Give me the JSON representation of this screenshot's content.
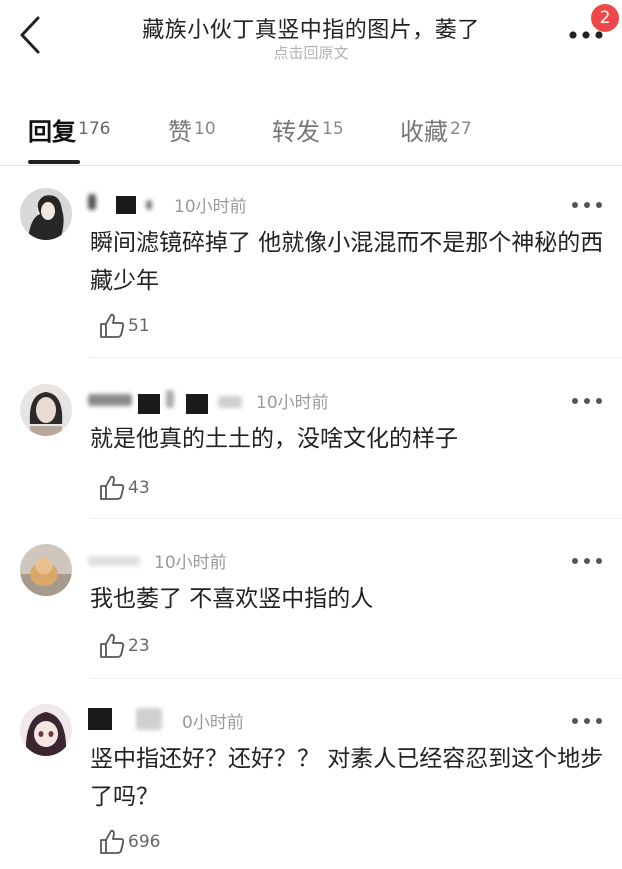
{
  "header": {
    "title": "藏族小伙丁真竖中指的图片，萎了",
    "subtitle": "点击回原文",
    "notification_badge": "2",
    "back_icon": "chevron-left-icon",
    "more_icon": "more-dots-icon"
  },
  "tabs": [
    {
      "label": "回复",
      "count": "176",
      "active": true
    },
    {
      "label": "赞",
      "count": "10",
      "active": false
    },
    {
      "label": "转发",
      "count": "15",
      "active": false
    },
    {
      "label": "收藏",
      "count": "27",
      "active": false
    }
  ],
  "comments": [
    {
      "time": "10小时前",
      "text": "瞬间滤镜碎掉了 他就像小混混而不是那个神秘的西藏少年",
      "likes": "51"
    },
    {
      "time": "10小时前",
      "text": "就是他真的土土的，没啥文化的样子",
      "likes": "43"
    },
    {
      "time": "10小时前",
      "text": "我也萎了 不喜欢竖中指的人",
      "likes": "23"
    },
    {
      "time": "0小时前",
      "text": "竖中指还好？还好？？ 对素人已经容忍到这个地步了吗？",
      "likes": "696"
    }
  ],
  "colors": {
    "badge": "#f04848",
    "muted_text": "#9a9a9a",
    "divider": "#eeeeee"
  }
}
